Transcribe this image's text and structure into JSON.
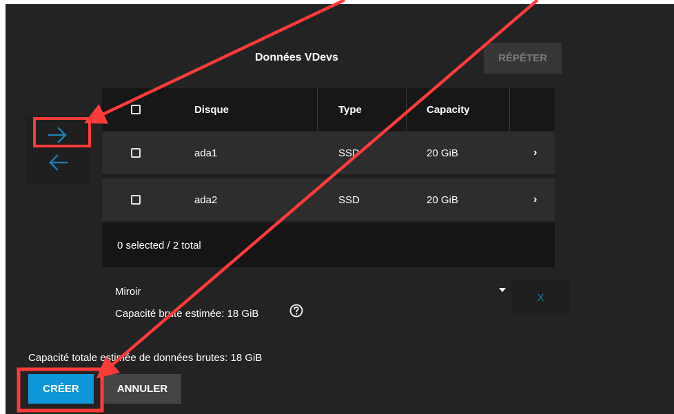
{
  "vdev": {
    "title": "Données VDevs",
    "repeat_label": "RÉPÉTER"
  },
  "icons": {
    "move_right": "arrow-right-icon",
    "move_left": "arrow-left-icon",
    "help": "help-circle-icon",
    "expand": "chevron-right-icon"
  },
  "table": {
    "headers": {
      "disk": "Disque",
      "type": "Type",
      "capacity": "Capacity"
    },
    "rows": [
      {
        "disk": "ada1",
        "type": "SSD",
        "capacity": "20 GiB",
        "more": "›"
      },
      {
        "disk": "ada2",
        "type": "SSD",
        "capacity": "20 GiB",
        "more": "›"
      }
    ],
    "footer": "0 selected / 2 total"
  },
  "layout_select": {
    "value": "Miroir"
  },
  "estimate": {
    "raw_capacity": "Capacité brute estimée: 18 GiB"
  },
  "remove_label": "X",
  "total": {
    "label": "Capacité totale estimée de données brutes: 18 GiB"
  },
  "actions": {
    "create": "CRÉER",
    "cancel": "ANNULER"
  },
  "colors": {
    "panel_bg": "#232323",
    "primary": "#0f96d8",
    "arrow_accent": "#1e7bb4",
    "annotation": "#ff3b3b"
  }
}
